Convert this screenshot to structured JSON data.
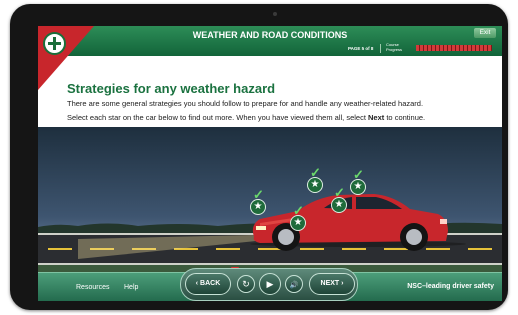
{
  "header": {
    "title": "WEATHER AND ROAD CONDITIONS",
    "exit_label": "Exit",
    "page_indicator": "PAGE 5 of 8",
    "progress_label_1": "Course",
    "progress_label_2": "Progress"
  },
  "content": {
    "heading": "Strategies for any weather hazard",
    "line1": "There are some general strategies you should follow to prepare for and handle any weather-related hazard.",
    "line2_before": "Select each star on the car below to find out more. When you have viewed them all, select ",
    "line2_bold": "Next",
    "line2_after": " to continue."
  },
  "stars": {
    "glyph": "★",
    "check_glyph": "✓",
    "count": 5,
    "all_viewed": true
  },
  "footer": {
    "resources_label": "Resources",
    "help_label": "Help",
    "tagline": "NSC–leading driver safety"
  },
  "controls": {
    "back_label": "BACK",
    "back_glyph": "‹",
    "replay_glyph": "↻",
    "play_glyph": "▶",
    "audio_glyph": "🔊",
    "next_label": "NEXT",
    "next_glyph": "›"
  },
  "colors": {
    "brand_green": "#1b7240",
    "car_red": "#c8262c",
    "progress_red": "#ba2b2b"
  }
}
